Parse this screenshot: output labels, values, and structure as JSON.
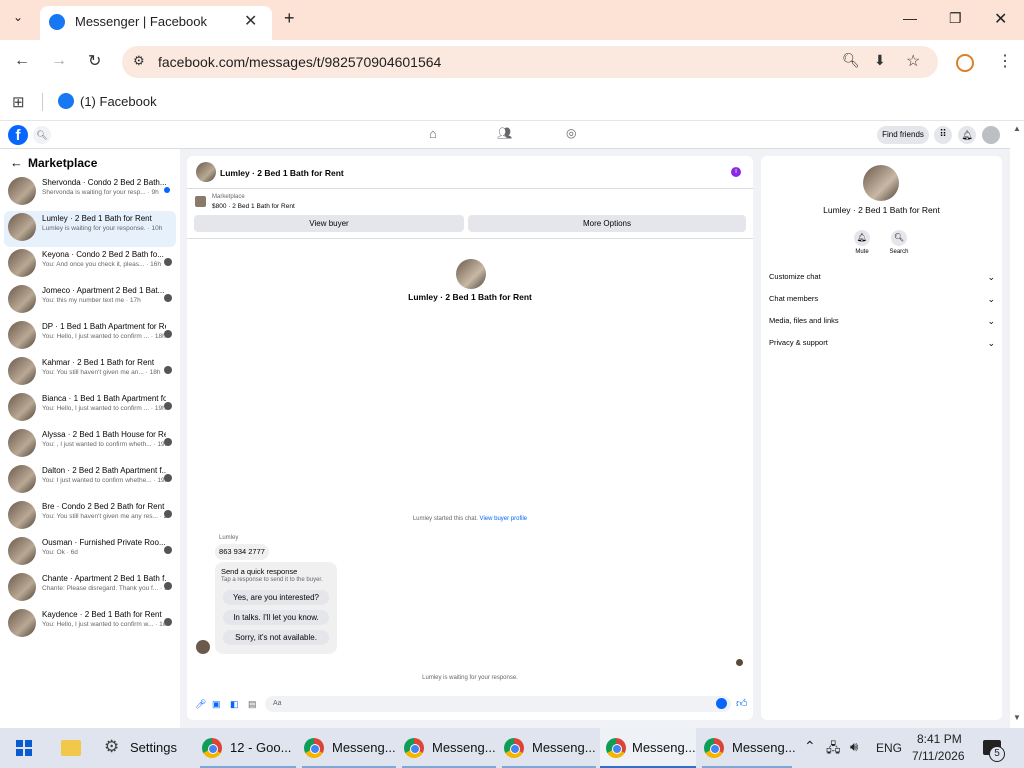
{
  "browser": {
    "tab_title": "Messenger | Facebook",
    "url": "facebook.com/messages/t/982570904601564",
    "bookmark_label": "(1) Facebook"
  },
  "fb_header": {
    "find_friends": "Find friends"
  },
  "sidebar": {
    "title": "Marketplace",
    "conversations": [
      {
        "name": "Shervonda · Condo 2 Bed 2 Bath...",
        "preview": "Shervonda is waiting for your resp... · 9h",
        "unread": true
      },
      {
        "name": "Lumley · 2 Bed 1 Bath for Rent",
        "preview": "Lumley is waiting for your response. · 10h",
        "selected": true
      },
      {
        "name": "Keyona · Condo 2 Bed 2 Bath fo...",
        "preview": "You: And once you check it, pleas... · 16h"
      },
      {
        "name": "Jomeco · Apartment 2 Bed 1 Bat...",
        "preview": "You: this my number text me · 17h"
      },
      {
        "name": "DP · 1 Bed 1 Bath Apartment for Re...",
        "preview": "You: Hello, I just wanted to confirm ... · 18h"
      },
      {
        "name": "Kahmar · 2 Bed 1 Bath for Rent",
        "preview": "You: You still haven't given me an... · 18h"
      },
      {
        "name": "Bianca · 1 Bed 1 Bath Apartment fo...",
        "preview": "You: Hello, I just wanted to confirm ... · 19h"
      },
      {
        "name": "Alyssa · 2 Bed 1 Bath House for Rent",
        "preview": "You: , I just wanted to confirm wheth... · 19h"
      },
      {
        "name": "Dalton · 2 Bed 2 Bath Apartment f...",
        "preview": "You: I just wanted to confirm whethe... · 19h"
      },
      {
        "name": "Bre · Condo 2 Bed 2 Bath for Rent",
        "preview": "You: You still haven't given me any res... · 2d"
      },
      {
        "name": "Ousman · Furnished Private Roo...",
        "preview": "You: Ok · 6d"
      },
      {
        "name": "Chante · Apartment 2 Bed 1 Bath f...",
        "preview": "Chante: Please disregard. Thank you f... · 1w"
      },
      {
        "name": "Kaydence · 2 Bed 1 Bath for Rent",
        "preview": "You: Hello, I just wanted to confirm w... · 1w"
      }
    ]
  },
  "chat": {
    "header_title": "Lumley · 2 Bed 1 Bath for Rent",
    "listing_source": "Marketplace",
    "listing_price": "$800 · 2 Bed 1 Bath for Rent",
    "view_buyer": "View buyer",
    "more_options": "More Options",
    "profile_name": "Lumley · 2 Bed 1 Bath for Rent",
    "started_text": "Lumley started this chat.",
    "view_buyer_profile": "View buyer profile",
    "sender_name": "Lumley",
    "message": "863 934 2777",
    "quick_title": "Send a quick response",
    "quick_subtitle": "Tap a response to send it to the buyer.",
    "quick_replies": [
      "Yes, are you interested?",
      "In talks. I'll let you know.",
      "Sorry, it's not available."
    ],
    "waiting_text": "Lumley is waiting for your response.",
    "composer_placeholder": "Aa"
  },
  "info": {
    "title": "Lumley · 2 Bed 1 Bath for Rent",
    "mute": "Mute",
    "search": "Search",
    "sections": [
      "Customize chat",
      "Chat members",
      "Media, files and links",
      "Privacy & support"
    ]
  },
  "taskbar": {
    "settings": "Settings",
    "items": [
      "12 - Goo...",
      "Messeng...",
      "Messeng...",
      "Messeng...",
      "Messeng...",
      "Messeng..."
    ],
    "lang": "ENG",
    "time": "8:41 PM",
    "date": "7/11/2026",
    "notif_count": "5"
  },
  "colors": {
    "accent": "#0866ff",
    "tab_bg": "#fce3d6",
    "content_bg": "#f0f2f5"
  }
}
